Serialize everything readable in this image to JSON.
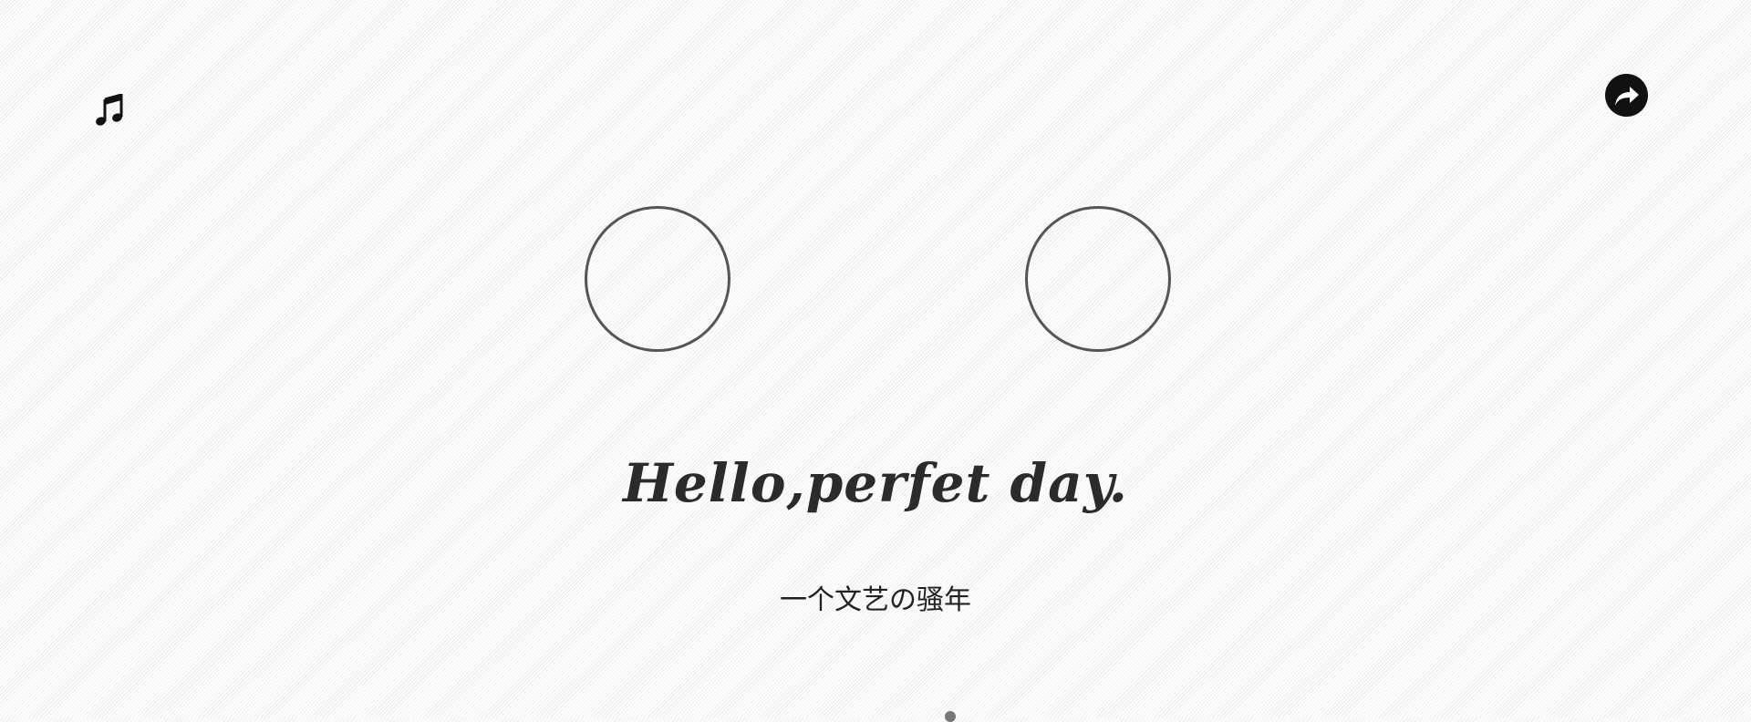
{
  "header": {
    "music_icon": "music-note-icon",
    "share_icon": "share-arrow-icon"
  },
  "hero": {
    "title": "Hello,perfet  day.",
    "subtitle": "一个文艺の骚年"
  },
  "colors": {
    "accent": "#111111",
    "avatar_border": "#555555",
    "title": "#2b2b2b"
  }
}
